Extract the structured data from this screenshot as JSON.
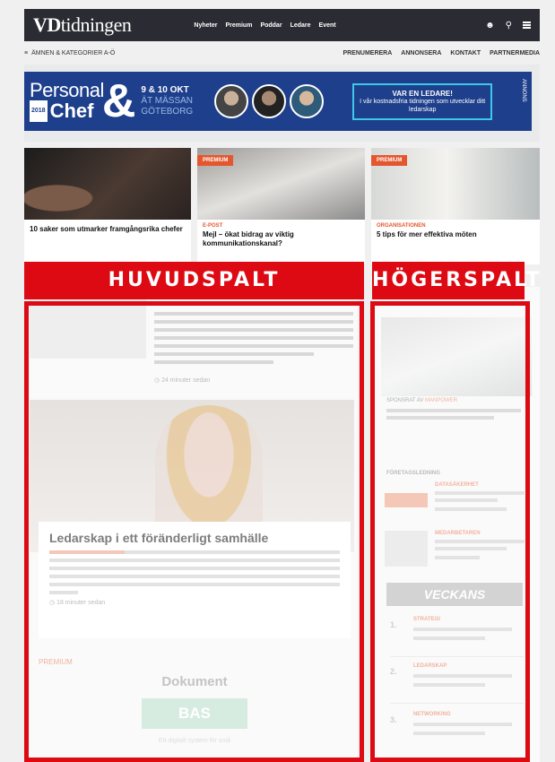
{
  "header": {
    "logo_bold": "VD",
    "logo_rest": "tidningen",
    "nav": [
      "Nyheter",
      "Premium",
      "Poddar",
      "Ledare",
      "Event"
    ],
    "icons": [
      "user-icon",
      "search-icon",
      "menu-icon"
    ]
  },
  "subbar": {
    "left_label": "ÄMNEN & KATEGORIER A-Ö",
    "right_links": [
      "PRENUMERERA",
      "ANNONSERA",
      "KONTAKT",
      "PARTNERMEDIA"
    ]
  },
  "banner": {
    "line1": "Personal",
    "line2": "Chef",
    "tag": "2018",
    "amp": "&",
    "date1": "9 & 10 OKT",
    "date2": "ÄT MÄSSAN",
    "date3": "GÖTEBORG",
    "cta_head": "VAR EN LEDARE!",
    "cta_text": "I vår kostnadsfria tidningen som utvecklar ditt ledarskap",
    "side": "ANNONS"
  },
  "cards": [
    {
      "badge": "",
      "kicker": "",
      "title": "10 saker som utmarker framgångsrika chefer"
    },
    {
      "badge": "PREMIUM",
      "kicker": "E-POST",
      "title": "Mejl – ökat bidrag av viktig kommunikationskanal?"
    },
    {
      "badge": "PREMIUM",
      "kicker": "ORGANISATIONEN",
      "title": "5 tips för mer effektiva möten"
    }
  ],
  "annotations": {
    "main": "HUVUDSPALT",
    "right": "HÖGERSPALT"
  },
  "main": {
    "time1": "24 minuter sedan",
    "feature_title": "Ledarskap i ett föränderligt samhälle",
    "time2": "18 minuter sedan",
    "kicker": "PREMIUM",
    "doc_heading": "Dokument",
    "doc_button": "BAS",
    "doc_caption": "Ett digitalt system för små"
  },
  "right": {
    "label_prefix": "SPONSRAT AV",
    "label_brand": "MANPOWER",
    "head": "FÖRETAGSLEDNING",
    "items": [
      {
        "kicker": "DATASÄKERHET"
      },
      {
        "kicker": "MEDARBETAREN"
      }
    ],
    "veckans": "VECKANS",
    "rows": [
      {
        "num": "1.",
        "kicker": "STRATEGI"
      },
      {
        "num": "2.",
        "kicker": "LEDARSKAP"
      },
      {
        "num": "3.",
        "kicker": "NETWORKING"
      }
    ]
  }
}
